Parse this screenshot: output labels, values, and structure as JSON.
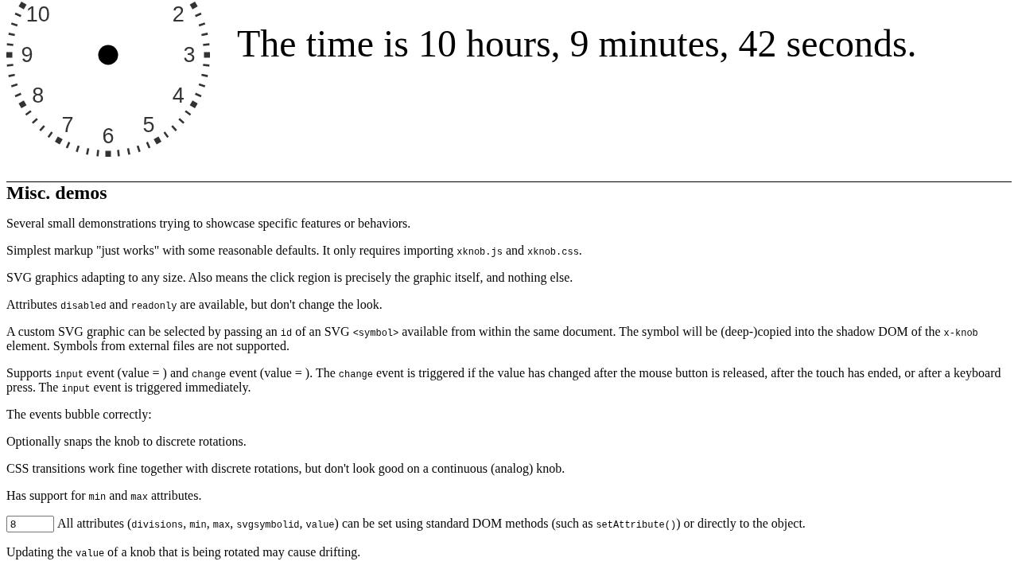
{
  "clock": {
    "numbers": [
      "10",
      "2",
      "9",
      "3",
      "8",
      "4",
      "7",
      "5",
      "6"
    ]
  },
  "time_text": "The time is 10 hours, 9 minutes, 42 seconds.",
  "section": {
    "heading": "Misc. demos",
    "paragraphs": [
      {
        "segments": [
          {
            "kind": "text",
            "text": "Several small demonstrations trying to showcase specific features or behaviors."
          }
        ]
      },
      {
        "segments": [
          {
            "kind": "text",
            "text": "Simplest markup \"just works\" with some reasonable defaults. It only requires importing "
          },
          {
            "kind": "code",
            "text": "xknob.js"
          },
          {
            "kind": "text",
            "text": " and "
          },
          {
            "kind": "code",
            "text": "xknob.css"
          },
          {
            "kind": "text",
            "text": "."
          }
        ]
      },
      {
        "segments": [
          {
            "kind": "text",
            "text": "SVG graphics adapting to any size. Also means the click region is precisely the graphic itself, and nothing else."
          }
        ]
      },
      {
        "segments": [
          {
            "kind": "text",
            "text": "Attributes "
          },
          {
            "kind": "code",
            "text": "disabled"
          },
          {
            "kind": "text",
            "text": " and "
          },
          {
            "kind": "code",
            "text": "readonly"
          },
          {
            "kind": "text",
            "text": " are available, but don't change the look."
          }
        ]
      },
      {
        "segments": [
          {
            "kind": "text",
            "text": "A custom SVG graphic can be selected by passing an "
          },
          {
            "kind": "code",
            "text": "id"
          },
          {
            "kind": "text",
            "text": " of an SVG "
          },
          {
            "kind": "code",
            "text": "<symbol>"
          },
          {
            "kind": "text",
            "text": " available from within the same document. The symbol will be (deep-)copied into the shadow DOM of the "
          },
          {
            "kind": "code",
            "text": "x-knob"
          },
          {
            "kind": "text",
            "text": " element. Symbols from external files are not supported."
          }
        ]
      },
      {
        "segments": [
          {
            "kind": "text",
            "text": "Supports "
          },
          {
            "kind": "code",
            "text": "input"
          },
          {
            "kind": "text",
            "text": " event (value = ) and "
          },
          {
            "kind": "code",
            "text": "change"
          },
          {
            "kind": "text",
            "text": " event (value = ). The "
          },
          {
            "kind": "code",
            "text": "change"
          },
          {
            "kind": "text",
            "text": " event is triggered if the value has changed after the mouse button is released, after the touch has ended, or after a keyboard press. The "
          },
          {
            "kind": "code",
            "text": "input"
          },
          {
            "kind": "text",
            "text": " event is triggered immediately."
          }
        ]
      },
      {
        "segments": [
          {
            "kind": "text",
            "text": "The events bubble correctly:"
          }
        ]
      },
      {
        "segments": [
          {
            "kind": "text",
            "text": "Optionally snaps the knob to discrete rotations."
          }
        ]
      },
      {
        "segments": [
          {
            "kind": "text",
            "text": "CSS transitions work fine together with discrete rotations, but don't look good on a continuous (analog) knob."
          }
        ]
      },
      {
        "segments": [
          {
            "kind": "text",
            "text": "Has support for "
          },
          {
            "kind": "code",
            "text": "min"
          },
          {
            "kind": "text",
            "text": " and "
          },
          {
            "kind": "code",
            "text": "max"
          },
          {
            "kind": "text",
            "text": " attributes."
          }
        ]
      },
      {
        "input": {
          "value": "8"
        },
        "segments": [
          {
            "kind": "text",
            "text": "All attributes ("
          },
          {
            "kind": "code",
            "text": "divisions"
          },
          {
            "kind": "text",
            "text": ", "
          },
          {
            "kind": "code",
            "text": "min"
          },
          {
            "kind": "text",
            "text": ", "
          },
          {
            "kind": "code",
            "text": "max"
          },
          {
            "kind": "text",
            "text": ", "
          },
          {
            "kind": "code",
            "text": "svgsymbolid"
          },
          {
            "kind": "text",
            "text": ", "
          },
          {
            "kind": "code",
            "text": "value"
          },
          {
            "kind": "text",
            "text": ") can be set using standard DOM methods (such as "
          },
          {
            "kind": "code",
            "text": "setAttribute()"
          },
          {
            "kind": "text",
            "text": ") or directly to the object."
          }
        ]
      },
      {
        "segments": [
          {
            "kind": "text",
            "text": "Updating the "
          },
          {
            "kind": "code",
            "text": "value"
          },
          {
            "kind": "text",
            "text": " of a knob that is being rotated may cause drifting."
          }
        ]
      }
    ]
  }
}
